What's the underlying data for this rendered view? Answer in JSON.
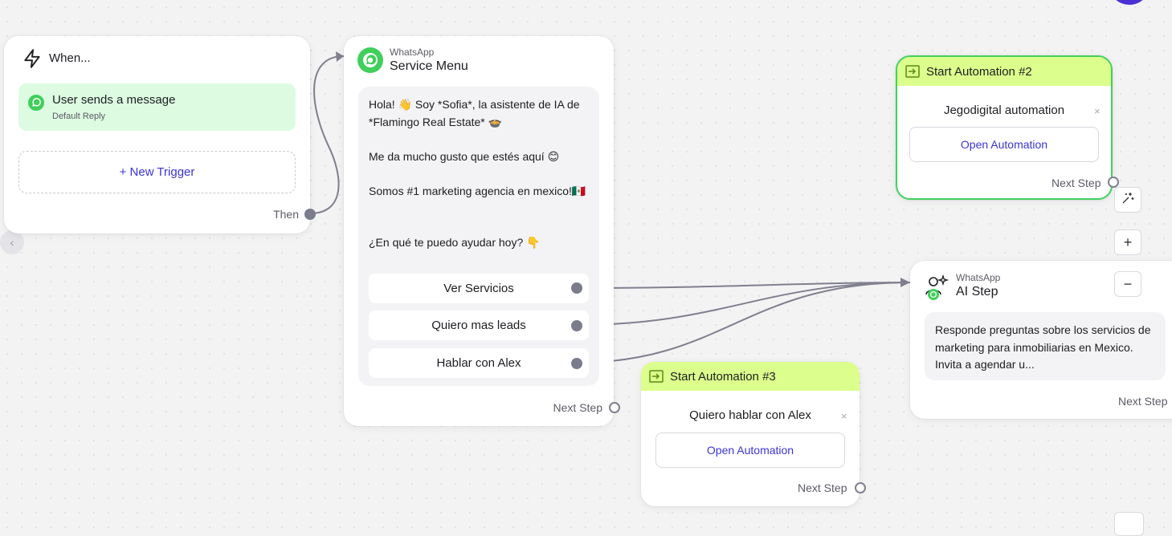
{
  "trigger": {
    "title": "When...",
    "item_label": "User sends a message",
    "item_sub": "Default Reply",
    "new_trigger": "+ New Trigger",
    "then": "Then"
  },
  "service_menu": {
    "kicker": "WhatsApp",
    "title": "Service Menu",
    "message": "Hola! 👋 Soy *Sofia*, la asistente de IA de *Flamingo Real Estate* 🍲\n\nMe da mucho gusto que estés aquí 😊\n\nSomos #1 marketing agencia en mexico!🇲🇽\n\n\n¿En qué te puedo ayudar hoy? 👇",
    "quick_replies": [
      "Ver Servicios",
      "Quiero mas leads",
      "Hablar con Alex"
    ],
    "next_step": "Next Step"
  },
  "automation2": {
    "header": "Start Automation #2",
    "name": "Jegodigital automation",
    "open": "Open Automation",
    "next_step": "Next Step",
    "close": "×"
  },
  "automation3": {
    "header": "Start Automation #3",
    "name": "Quiero hablar con Alex",
    "open": "Open Automation",
    "next_step": "Next Step",
    "close": "×"
  },
  "ai_step": {
    "kicker": "WhatsApp",
    "title": "AI Step",
    "description": "Responde preguntas sobre los servicios de marketing para inmobiliarias en Mexico. Invita a agendar u...",
    "next_step": "Next Step"
  },
  "tools": {
    "magic": "⚹",
    "zoom_in": "+",
    "zoom_out": "−",
    "collapse": "‹"
  },
  "colors": {
    "whatsapp_green": "#3fcf5a",
    "accent_link": "#3b34d6",
    "automation_header": "#dcfe8c",
    "trigger_item_bg": "#dcfbe1",
    "edge": "#80808e"
  }
}
